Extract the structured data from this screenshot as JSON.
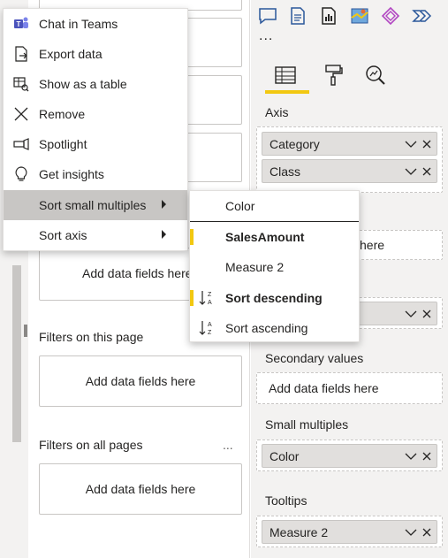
{
  "context_menu": {
    "items": [
      {
        "label": "Chat in Teams",
        "icon": "teams-icon"
      },
      {
        "label": "Export data",
        "icon": "export-icon"
      },
      {
        "label": "Show as a table",
        "icon": "table-icon"
      },
      {
        "label": "Remove",
        "icon": "close-icon"
      },
      {
        "label": "Spotlight",
        "icon": "spotlight-icon"
      },
      {
        "label": "Get insights",
        "icon": "lightbulb-icon"
      },
      {
        "label": "Sort small multiples",
        "icon": "",
        "submenu": true,
        "active": true
      },
      {
        "label": "Sort axis",
        "icon": "",
        "submenu": true
      }
    ]
  },
  "sub_menu": {
    "items": [
      {
        "label": "Color",
        "selected": false
      },
      {
        "label": "SalesAmount",
        "selected": true
      },
      {
        "label": "Measure 2",
        "selected": false
      },
      {
        "label": "Sort descending",
        "selected": true,
        "icon": "sort-descending-icon"
      },
      {
        "label": "Sort ascending",
        "selected": false,
        "icon": "sort-ascending-icon"
      }
    ]
  },
  "filters": {
    "visual_add": "Add data fields here",
    "page_label": "Filters on this page",
    "page_add": "Add data fields here",
    "all_label": "Filters on all pages",
    "all_more": "...",
    "all_add": "Add data fields here"
  },
  "viz": {
    "more": "...",
    "axis_label": "Axis",
    "axis_fields": [
      "Category",
      "Class"
    ],
    "legend_add": "here",
    "secondary_label": "Secondary values",
    "secondary_add": "Add data fields here",
    "small_multiples_label": "Small multiples",
    "small_multiples_field": "Color",
    "tooltips_label": "Tooltips",
    "tooltips_field": "Measure 2"
  },
  "colors": {
    "accent_yellow": "#f2c811",
    "icon_blue": "#2b579a",
    "pane_bg": "#f3f2f1"
  }
}
